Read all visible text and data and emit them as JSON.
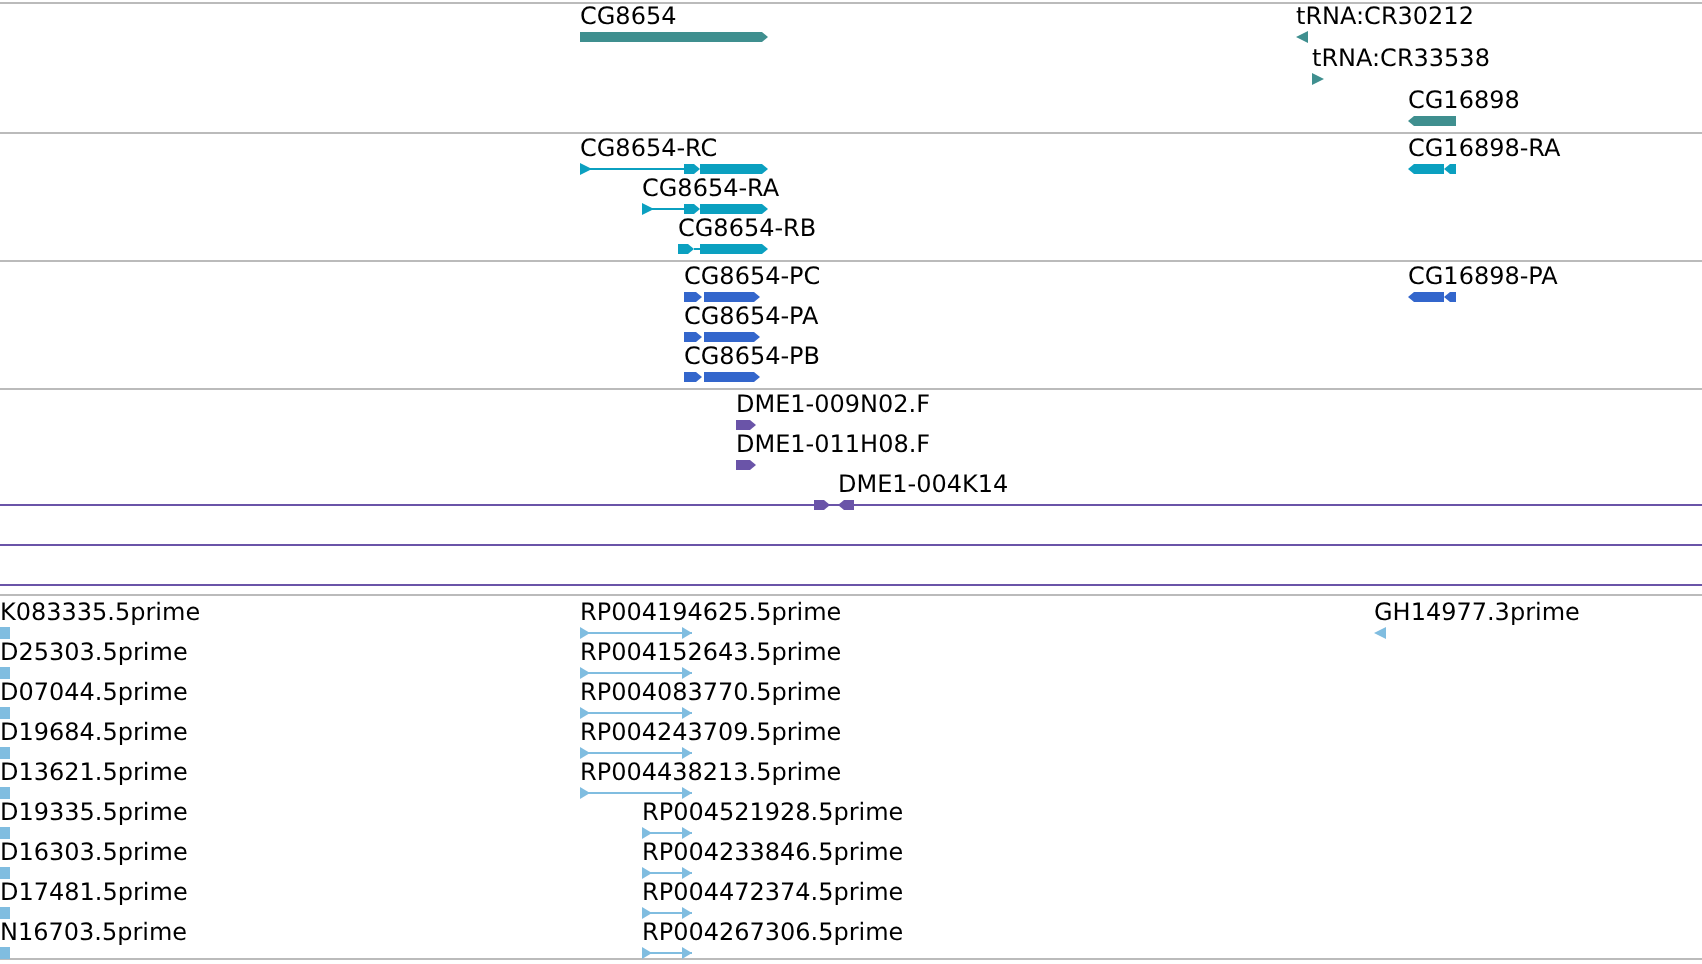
{
  "tracks": [
    {
      "color": "#3f8f8f",
      "features": [
        {
          "kind": "gene",
          "label": "CG8654",
          "reverse": false
        },
        {
          "kind": "trna",
          "label": "tRNA:CR30212",
          "reverse": true
        },
        {
          "kind": "trna",
          "label": "tRNA:CR33538",
          "reverse": false
        },
        {
          "kind": "gene",
          "label": "CG16898",
          "reverse": true
        }
      ]
    },
    {
      "color": "#0ba0c0",
      "features": [
        {
          "kind": "transcript",
          "label": "CG8654-RC",
          "reverse": false
        },
        {
          "kind": "transcript",
          "label": "CG8654-RA",
          "reverse": false
        },
        {
          "kind": "transcript",
          "label": "CG8654-RB",
          "reverse": false
        },
        {
          "kind": "transcript",
          "label": "CG16898-RA",
          "reverse": true
        }
      ]
    },
    {
      "color": "#3366cc",
      "features": [
        {
          "kind": "protein",
          "label": "CG8654-PC",
          "reverse": false
        },
        {
          "kind": "protein",
          "label": "CG8654-PA",
          "reverse": false
        },
        {
          "kind": "protein",
          "label": "CG8654-PB",
          "reverse": false
        },
        {
          "kind": "protein",
          "label": "CG16898-PA",
          "reverse": true
        }
      ]
    },
    {
      "color": "#6a54a8",
      "features": [
        {
          "kind": "clone_read",
          "label": "DME1-009N02.F",
          "reverse": false
        },
        {
          "kind": "clone_read",
          "label": "DME1-011H08.F",
          "reverse": false
        },
        {
          "kind": "clone_pair",
          "label": "DME1-004K14"
        },
        {
          "kind": "clone_pair"
        },
        {
          "kind": "clone_pair"
        }
      ]
    },
    {
      "color": "#80bde0",
      "features": [
        {
          "kind": "est",
          "label": "K083335.5prime"
        },
        {
          "kind": "est",
          "label": "D25303.5prime"
        },
        {
          "kind": "est",
          "label": "D07044.5prime"
        },
        {
          "kind": "est",
          "label": "D19684.5prime"
        },
        {
          "kind": "est",
          "label": "D13621.5prime"
        },
        {
          "kind": "est",
          "label": "D19335.5prime"
        },
        {
          "kind": "est",
          "label": "D16303.5prime"
        },
        {
          "kind": "est",
          "label": "D17481.5prime"
        },
        {
          "kind": "est",
          "label": "N16703.5prime"
        },
        {
          "kind": "est",
          "label": "RP004194625.5prime",
          "reverse": false
        },
        {
          "kind": "est",
          "label": "RP004152643.5prime",
          "reverse": false
        },
        {
          "kind": "est",
          "label": "RP004083770.5prime",
          "reverse": false
        },
        {
          "kind": "est",
          "label": "RP004243709.5prime",
          "reverse": false
        },
        {
          "kind": "est",
          "label": "RP004438213.5prime",
          "reverse": false
        },
        {
          "kind": "est",
          "label": "RP004521928.5prime",
          "reverse": false
        },
        {
          "kind": "est",
          "label": "RP004233846.5prime",
          "reverse": false
        },
        {
          "kind": "est",
          "label": "RP004472374.5prime",
          "reverse": false
        },
        {
          "kind": "est",
          "label": "RP004267306.5prime",
          "reverse": false
        },
        {
          "kind": "est",
          "label": "GH14977.3prime",
          "reverse": true
        }
      ]
    }
  ]
}
